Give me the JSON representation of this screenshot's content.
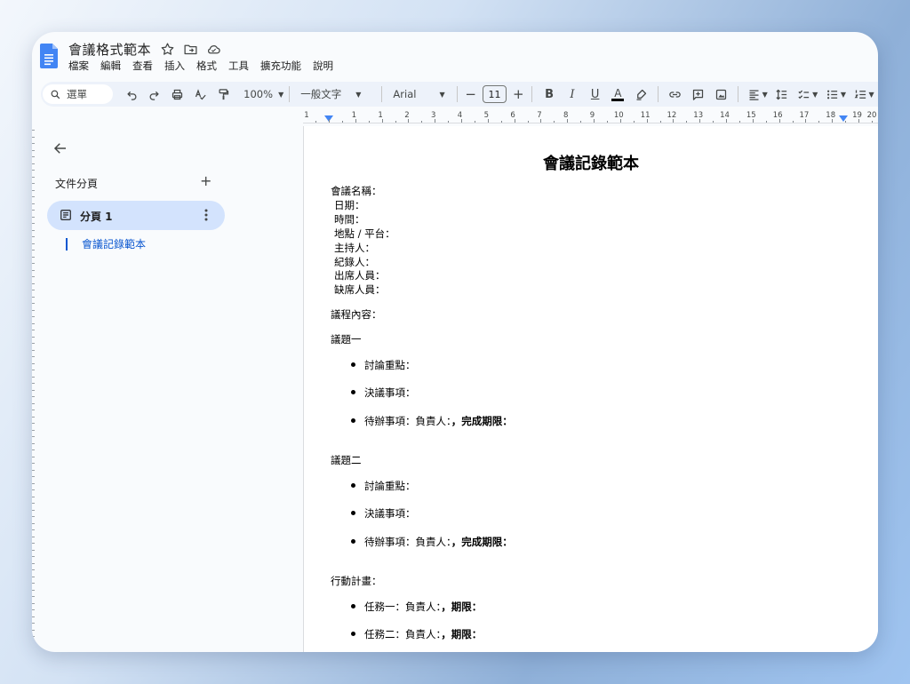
{
  "app": {
    "doc_title": "會議格式範本",
    "menu": [
      "檔案",
      "編輯",
      "查看",
      "插入",
      "格式",
      "工具",
      "擴充功能",
      "說明"
    ]
  },
  "toolbar": {
    "search_label": "選單",
    "zoom": "100%",
    "style": "一般文字",
    "font": "Arial",
    "font_size": "11",
    "bold": "B",
    "italic": "I",
    "underline": "U",
    "text_color": "A"
  },
  "ruler": {
    "labels": [
      "1",
      "1",
      "1",
      "2",
      "3",
      "4",
      "5",
      "6",
      "7",
      "8",
      "9",
      "10",
      "11",
      "12",
      "13",
      "14",
      "15",
      "16",
      "17",
      "18",
      "19",
      "20"
    ]
  },
  "sidebar": {
    "outline_title": "文件分頁",
    "tab_label": "分頁 1",
    "heading": "會議記錄範本"
  },
  "document": {
    "title": "會議記錄範本",
    "meta": [
      "會議名稱：",
      "日期：",
      "時間：",
      "地點 / 平台：",
      "主持人：",
      "紀錄人：",
      "出席人員：",
      "缺席人員："
    ],
    "agenda_label": "議程內容：",
    "topic1": "議題一",
    "topic2": "議題二",
    "discussion": "討論重點：",
    "resolution": "決議事項：",
    "todo_prefix": "待辦事項：負責人：",
    "todo_deadline": "，完成期限：",
    "action_plan": "行動計畫：",
    "task1_prefix": "任務一：負責人：",
    "task2_prefix": "任務二：負責人：",
    "task_deadline": "，期限："
  },
  "colors": {
    "accent": "#0b57d0",
    "toolbar_bg": "#edf2fa",
    "tab_bg": "#d3e3fd",
    "docs_blue": "#4285f4"
  }
}
